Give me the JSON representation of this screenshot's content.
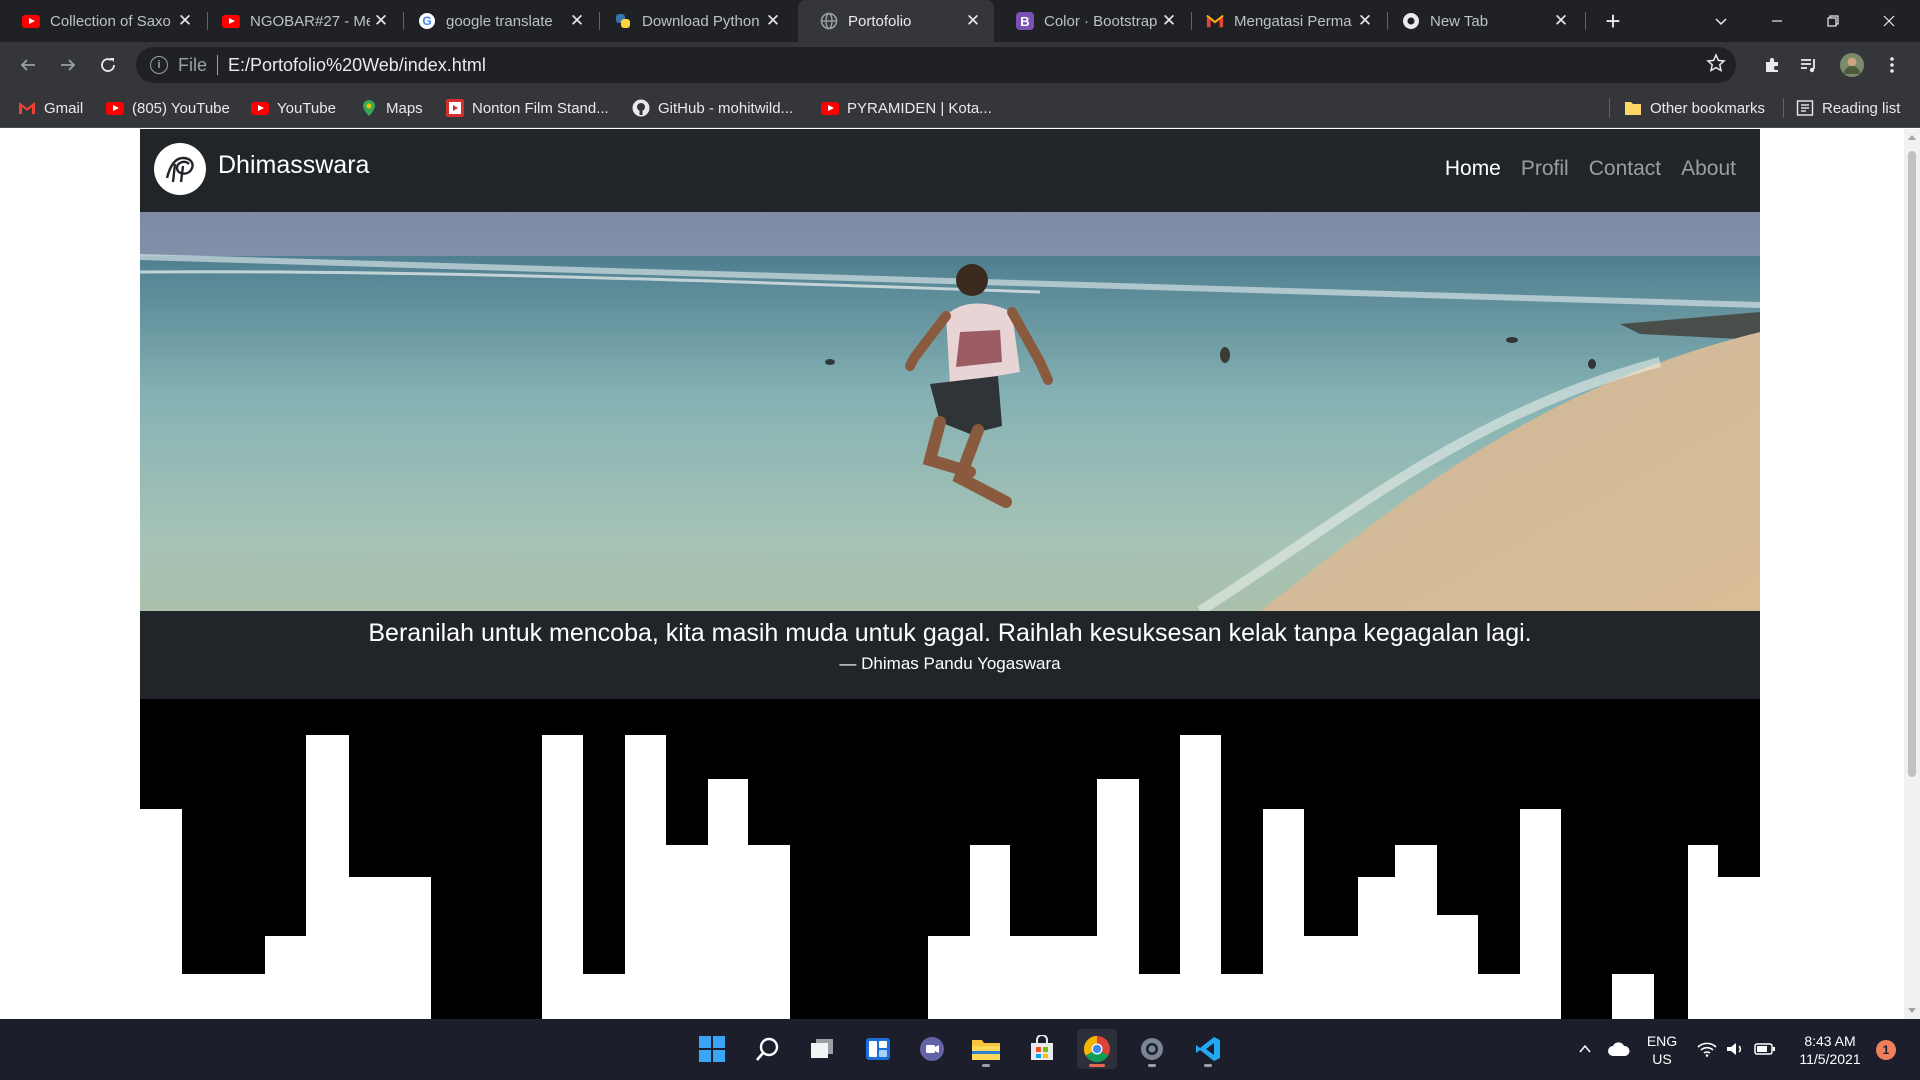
{
  "browser": {
    "tabs": [
      {
        "title": "Collection of Saxo",
        "icon": "youtube-icon"
      },
      {
        "title": "NGOBAR#27 - Me",
        "icon": "youtube-icon"
      },
      {
        "title": "google translate",
        "icon": "google-icon"
      },
      {
        "title": "Download Python",
        "icon": "python-icon"
      },
      {
        "title": "Portofolio",
        "icon": "globe-icon",
        "active": true
      },
      {
        "title": "Color · Bootstrap",
        "icon": "bootstrap-icon"
      },
      {
        "title": "Mengatasi Perma",
        "icon": "gmail-icon"
      },
      {
        "title": "New Tab",
        "icon": "chrome-icon"
      }
    ],
    "close_glyph": "✕",
    "new_tab_glyph": "+",
    "address": {
      "scheme_label": "File",
      "url": "E:/Portofolio%20Web/index.html"
    },
    "bookmarks": [
      {
        "label": "Gmail",
        "icon": "gmail-icon"
      },
      {
        "label": "(805) YouTube",
        "icon": "youtube-icon"
      },
      {
        "label": "YouTube",
        "icon": "youtube-icon"
      },
      {
        "label": "Maps",
        "icon": "maps-icon"
      },
      {
        "label": "Nonton Film Stand...",
        "icon": "film-icon"
      },
      {
        "label": "GitHub - mohitwild...",
        "icon": "github-icon"
      },
      {
        "label": "PYRAMIDEN | Kota...",
        "icon": "youtube-icon"
      }
    ],
    "other_bookmarks": "Other bookmarks",
    "reading_list": "Reading list"
  },
  "site": {
    "brand_name": "Dhimasswara",
    "nav": [
      {
        "label": "Home",
        "active": true
      },
      {
        "label": "Profil",
        "active": false
      },
      {
        "label": "Contact",
        "active": false
      },
      {
        "label": "About",
        "active": false
      }
    ],
    "quote": {
      "text": "Beranilah untuk mencoba, kita masih muda untuk gagal. Raihlah kesuksesan kelak tanpa kegagalan lagi.",
      "author": "— Dhimas Pandu Yogaswara"
    }
  },
  "taskbar": {
    "apps": [
      "start-icon",
      "search-icon",
      "task-view-icon",
      "widgets-icon",
      "teams-chat-icon",
      "file-explorer-icon",
      "store-icon",
      "chrome-icon",
      "settings-icon",
      "vscode-icon"
    ],
    "language": "ENG",
    "region": "US",
    "time": "8:43 AM",
    "date": "11/5/2021",
    "notification_count": "1"
  },
  "colors": {
    "chrome_dark": "#202124",
    "toolbar": "#35363a",
    "navbar": "#212529",
    "taskbar": "#1c1f2b"
  }
}
